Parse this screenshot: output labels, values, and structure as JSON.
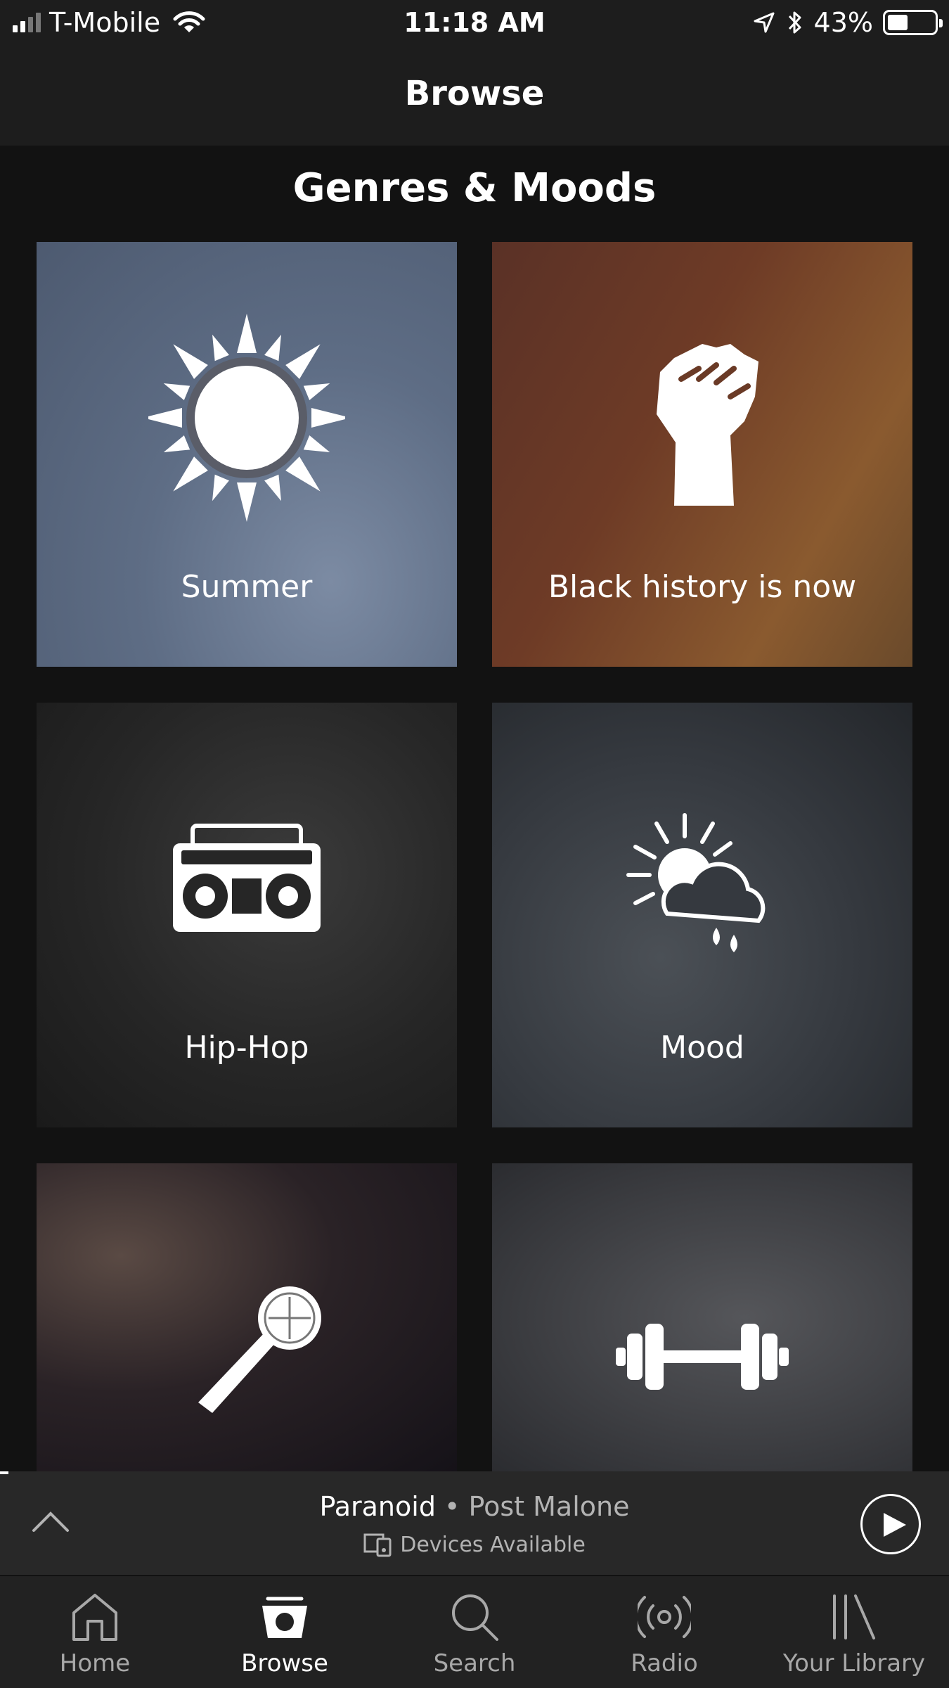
{
  "status_bar": {
    "carrier": "T-Mobile",
    "time": "11:18 AM",
    "battery": "43%",
    "battery_level": 0.43
  },
  "header": {
    "title": "Browse"
  },
  "section": {
    "title": "Genres & Moods"
  },
  "tiles": [
    {
      "label": "Summer",
      "icon": "sun-icon"
    },
    {
      "label": "Black history is now",
      "icon": "raised-fist-icon"
    },
    {
      "label": "Hip-Hop",
      "icon": "boombox-icon"
    },
    {
      "label": "Mood",
      "icon": "sun-cloud-rain-icon"
    },
    {
      "label": "",
      "icon": "microphone-icon"
    },
    {
      "label": "",
      "icon": "dumbbell-icon"
    }
  ],
  "now_playing": {
    "track": "Paranoid",
    "separator": " • ",
    "artist": "Post Malone",
    "devices": "Devices Available"
  },
  "tabs": [
    {
      "label": "Home",
      "icon": "home-icon",
      "active": false
    },
    {
      "label": "Browse",
      "icon": "browse-icon",
      "active": true
    },
    {
      "label": "Search",
      "icon": "search-icon",
      "active": false
    },
    {
      "label": "Radio",
      "icon": "radio-icon",
      "active": false
    },
    {
      "label": "Your Library",
      "icon": "library-icon",
      "active": false
    }
  ],
  "colors": {
    "background": "#121212",
    "header": "#1d1d1d",
    "now_playing_bar": "#282828",
    "tab_bar": "#222222",
    "secondary_text": "#b3b3b3"
  }
}
